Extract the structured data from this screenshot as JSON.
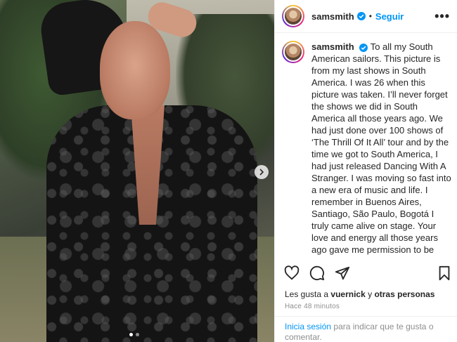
{
  "post": {
    "image_alt": "photo of man in black lace shirt",
    "carousel": {
      "current": 1,
      "total": 2
    }
  },
  "header": {
    "username": "samsmith",
    "separator": "•",
    "follow_label": "Seguir",
    "more_label": "•••"
  },
  "caption": {
    "username": "samsmith",
    "text": "To all my South American sailors. This picture is from my last shows in South America. I was 26 when this picture was taken. I’ll never forget the shows we did in South America all those years ago. We had just done over 100 shows of ‘The Thrill Of It All’ tour and by the time we got to South America, I had just released Dancing With A Stranger. I was moving so fast into a new era of music and life. I remember in Buenos Aires, Santiago, São Paulo, Bogotá I truly came alive on stage. Your love and energy all those years ago gave me permission to be myself and move and sing in ways I never thought possible. This is a full circle moment for me. I am so excited to be with you again, after all these years and after so"
  },
  "actions": {
    "icons": [
      "heart-icon",
      "comment-icon",
      "share-icon",
      "bookmark-icon"
    ]
  },
  "likes": {
    "prefix": "Les gusta a",
    "user": "vuernick",
    "connector": "y",
    "others": "otras personas"
  },
  "timestamp": "Hace 48 minutos",
  "login_prompt": {
    "link": "Inicia sesión",
    "text": "para indicar que te gusta o comentar."
  },
  "colors": {
    "accent": "#0095f6",
    "text": "#262626",
    "muted": "#8e8e8e",
    "border": "#efefef"
  }
}
